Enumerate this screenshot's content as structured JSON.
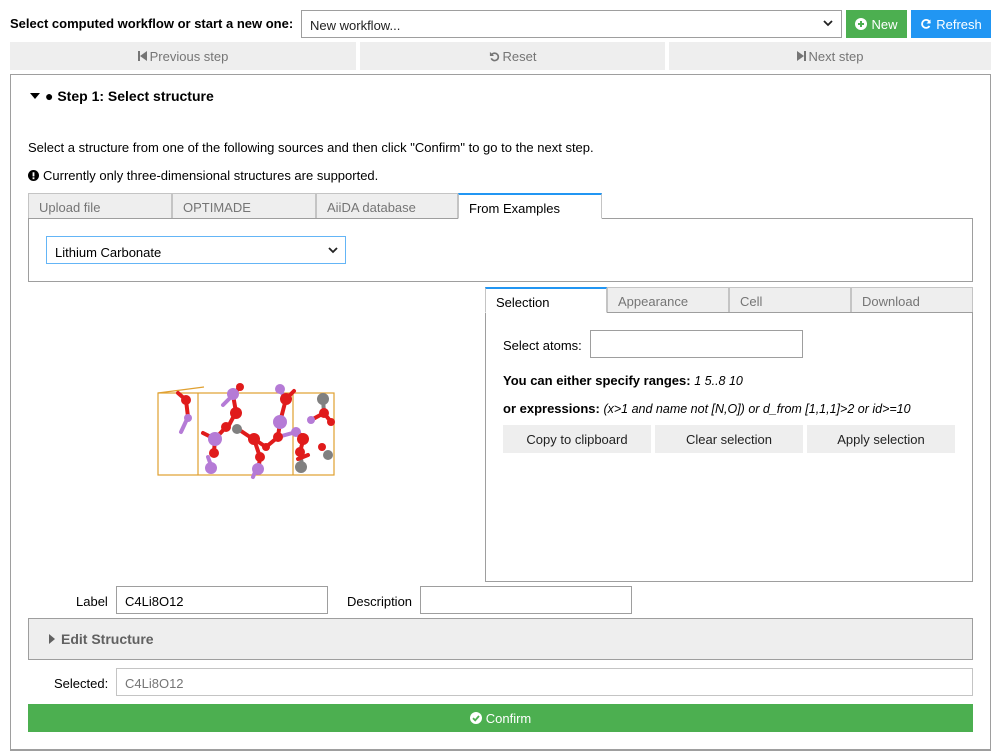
{
  "workflow": {
    "label": "Select computed workflow or start a new one:",
    "selected": "New workflow...",
    "new_button": "New",
    "refresh_button": "Refresh"
  },
  "nav": {
    "previous": "Previous step",
    "reset": "Reset",
    "next": "Next step"
  },
  "step": {
    "title": "● Step 1: Select structure",
    "intro": "Select a structure from one of the following sources and then click \"Confirm\" to go to the next step.",
    "note": "Currently only three-dimensional structures are supported."
  },
  "source_tabs": {
    "tabs": [
      "Upload file",
      "OPTIMADE",
      "AiiDA database",
      "From Examples"
    ],
    "active_index": 3,
    "example_selected": "Lithium Carbonate"
  },
  "viewer_tabs": {
    "tabs": [
      "Selection",
      "Appearance",
      "Cell",
      "Download"
    ],
    "active_index": 0
  },
  "selection": {
    "select_atoms_label": "Select atoms:",
    "select_atoms_value": "",
    "ranges_bold": "You can either specify ranges:",
    "ranges_example": "1 5..8 10",
    "expr_bold": "or expressions:",
    "expr_example": "(x>1 and name not [N,O]) or d_from [1,1,1]>2 or id>=10",
    "copy_button": "Copy to clipboard",
    "clear_button": "Clear selection",
    "apply_button": "Apply selection"
  },
  "structure": {
    "label_label": "Label",
    "label_value": "C4Li8O12",
    "description_label": "Description",
    "description_value": "",
    "edit_structure": "Edit Structure",
    "selected_label": "Selected:",
    "selected_value": "C4Li8O12",
    "confirm_button": "Confirm"
  },
  "colors": {
    "green": "#4caf50",
    "blue": "#2196f3",
    "lithium": "#b57bd6",
    "oxygen": "#e01b1b",
    "carbon": "#808080",
    "cell": "#e0a030"
  },
  "icons": [
    "chevron-down-icon",
    "plus-circle-icon",
    "refresh-icon",
    "step-backward-icon",
    "undo-icon",
    "step-forward-icon",
    "caret-down-icon",
    "info-circle-icon",
    "caret-right-icon",
    "check-circle-icon"
  ]
}
